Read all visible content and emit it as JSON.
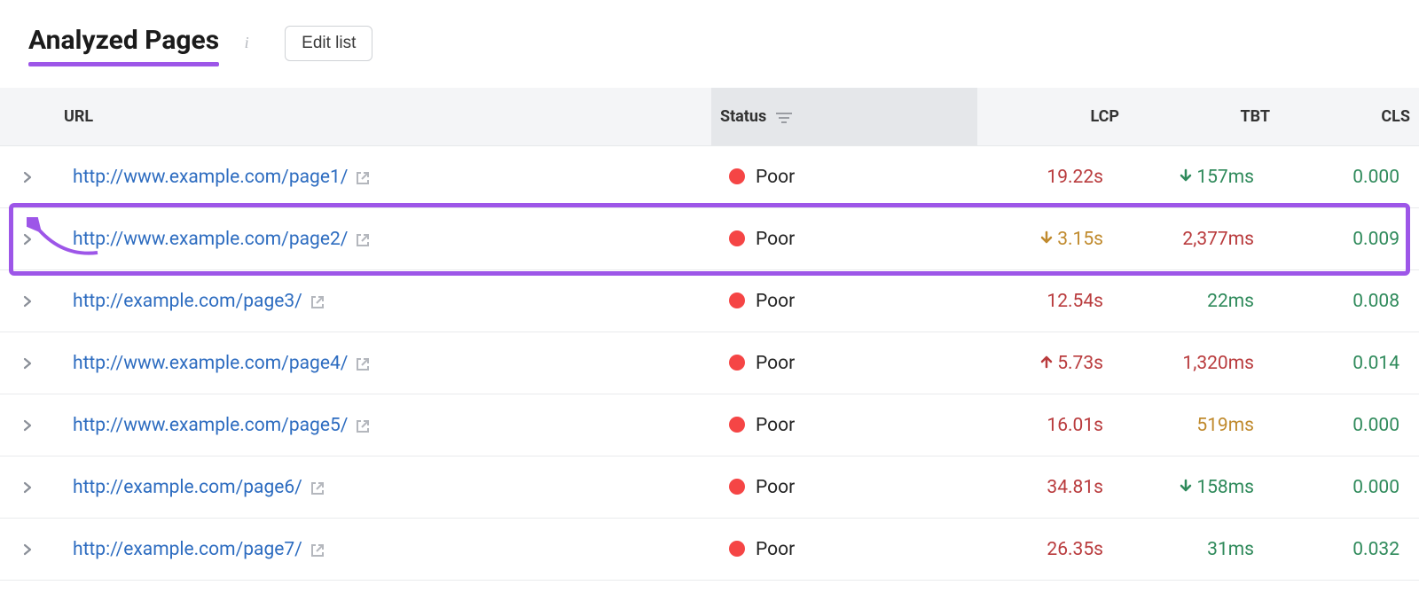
{
  "header": {
    "title": "Analyzed Pages",
    "edit_label": "Edit list"
  },
  "columns": {
    "url": "URL",
    "status": "Status",
    "lcp": "LCP",
    "tbt": "TBT",
    "cls": "CLS"
  },
  "status_labels": {
    "poor": "Poor"
  },
  "rows": [
    {
      "url": "http://www.example.com/page1/",
      "status": "poor",
      "lcp": "19.22s",
      "lcp_class": "val-red",
      "lcp_trend": "",
      "tbt": "157ms",
      "tbt_class": "val-green",
      "tbt_trend": "down-green",
      "cls": "0.000",
      "cls_class": "val-green"
    },
    {
      "url": "http://www.example.com/page2/",
      "status": "poor",
      "lcp": "3.15s",
      "lcp_class": "val-orange",
      "lcp_trend": "down-orange",
      "tbt": "2,377ms",
      "tbt_class": "val-red",
      "tbt_trend": "",
      "cls": "0.009",
      "cls_class": "val-green"
    },
    {
      "url": "http://example.com/page3/",
      "status": "poor",
      "lcp": "12.54s",
      "lcp_class": "val-red",
      "lcp_trend": "",
      "tbt": "22ms",
      "tbt_class": "val-green",
      "tbt_trend": "",
      "cls": "0.008",
      "cls_class": "val-green"
    },
    {
      "url": "http://www.example.com/page4/",
      "status": "poor",
      "lcp": "5.73s",
      "lcp_class": "val-red",
      "lcp_trend": "up-red",
      "tbt": "1,320ms",
      "tbt_class": "val-red",
      "tbt_trend": "",
      "cls": "0.014",
      "cls_class": "val-green"
    },
    {
      "url": "http://www.example.com/page5/",
      "status": "poor",
      "lcp": "16.01s",
      "lcp_class": "val-red",
      "lcp_trend": "",
      "tbt": "519ms",
      "tbt_class": "val-orange",
      "tbt_trend": "",
      "cls": "0.000",
      "cls_class": "val-green"
    },
    {
      "url": "http://example.com/page6/",
      "status": "poor",
      "lcp": "34.81s",
      "lcp_class": "val-red",
      "lcp_trend": "",
      "tbt": "158ms",
      "tbt_class": "val-green",
      "tbt_trend": "down-green",
      "cls": "0.000",
      "cls_class": "val-green"
    },
    {
      "url": "http://example.com/page7/",
      "status": "poor",
      "lcp": "26.35s",
      "lcp_class": "val-red",
      "lcp_trend": "",
      "tbt": "31ms",
      "tbt_class": "val-green",
      "tbt_trend": "",
      "cls": "0.032",
      "cls_class": "val-green"
    }
  ],
  "highlight_row_index": 1
}
